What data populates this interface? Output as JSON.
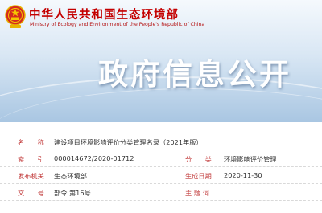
{
  "header": {
    "ministry_cn": "中华人民共和国生态环境部",
    "ministry_en": "Ministry of Ecology and Environment of the People's Republic of China",
    "page_title": "政府信息公开"
  },
  "metadata": {
    "name_label": "名　　称",
    "name_value": "建设项目环境影响评价分类管理名录（2021年版）",
    "index_label": "索　　引",
    "index_value": "000014672/2020-01712",
    "category_label": "分　　类",
    "category_value": "环境影响评价管理",
    "issuer_label": "发布机关",
    "issuer_value": "生态环境部",
    "date_label": "生成日期",
    "date_value": "2020-11-30",
    "docno_label": "文　　号",
    "docno_value": "部令 第16号",
    "keywords_label": "主 题 词",
    "keywords_value": ""
  },
  "colors": {
    "label": "#c23b3b",
    "ministry": "#c40000"
  }
}
